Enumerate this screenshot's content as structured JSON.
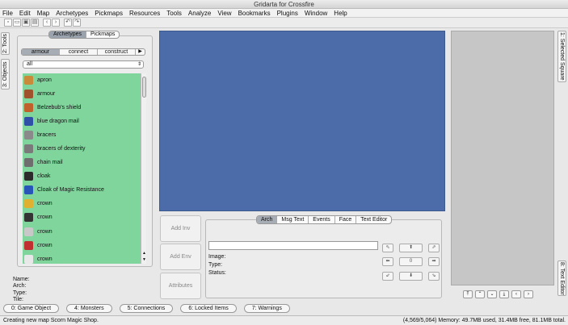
{
  "window": {
    "title": "Gridarta for Crossfire"
  },
  "menu": [
    "File",
    "Edit",
    "Map",
    "Archetypes",
    "Pickmaps",
    "Resources",
    "Tools",
    "Analyze",
    "View",
    "Bookmarks",
    "Plugins",
    "Window",
    "Help"
  ],
  "toolbar": {
    "buttons": [
      {
        "name": "new-map-icon",
        "glyph": "▫"
      },
      {
        "name": "open-map-icon",
        "glyph": "▭"
      },
      {
        "name": "save-map-icon",
        "glyph": "▣"
      },
      {
        "name": "save-all-icon",
        "glyph": "▤"
      },
      {
        "name": "back-icon",
        "glyph": "‹"
      },
      {
        "name": "forward-icon",
        "glyph": "›"
      },
      {
        "name": "undo-icon",
        "glyph": "↶"
      },
      {
        "name": "redo-icon",
        "glyph": "↷"
      }
    ]
  },
  "left_tabs": [
    "2: Tools",
    "3: Objects"
  ],
  "right_tabs": [
    "1: Selected Square",
    "8: Text Editor"
  ],
  "panel_tabs": [
    "Archetypes",
    "Pickmaps"
  ],
  "category_tabs": [
    "armour",
    "connect",
    "construct"
  ],
  "category_more": "▶",
  "filter": {
    "value": "all"
  },
  "archetypes": [
    {
      "label": "apron",
      "color": "#c98a3a"
    },
    {
      "label": "armour",
      "color": "#a0522d"
    },
    {
      "label": "Belzebub's shield",
      "color": "#c0602a"
    },
    {
      "label": "blue dragon mail",
      "color": "#3050a8"
    },
    {
      "label": "bracers",
      "color": "#8a8a8a"
    },
    {
      "label": "bracers of dexterity",
      "color": "#7a7a7a"
    },
    {
      "label": "chain mail",
      "color": "#6e6e6e"
    },
    {
      "label": "cloak",
      "color": "#2b2b2b"
    },
    {
      "label": "Cloak of Magic Resistance",
      "color": "#2855b8"
    },
    {
      "label": "crown",
      "color": "#e0b030"
    },
    {
      "label": "crown",
      "color": "#333333"
    },
    {
      "label": "crown",
      "color": "#c8c8c8"
    },
    {
      "label": "crown",
      "color": "#c03030"
    },
    {
      "label": "crown",
      "color": "#e8e8e8"
    }
  ],
  "info": {
    "name": "Name:",
    "arch": "Arch:",
    "type": "Type:",
    "tile": "Tile:"
  },
  "actions": {
    "add_inv": "Add Inv",
    "add_env": "Add Env",
    "attributes": "Attributes"
  },
  "attr_tabs": [
    "Arch",
    "Msg Text",
    "Events",
    "Face",
    "Text Editor"
  ],
  "attr_fields": {
    "image": "Image:",
    "type": "Type:",
    "status": "Status:"
  },
  "direction": {
    "value": "0"
  },
  "bottom_tabs": [
    "0: Game Object",
    "4: Monsters",
    "5: Connections",
    "6: Locked Items",
    "7: Warnings"
  ],
  "status": {
    "message": "Creating new map Scorn Magic Shop.",
    "info": "(4,569/5,064) Memory: 49.7MB used, 31.4MB free, 81.1MB total."
  },
  "colors": {
    "map": "#4b6ca8",
    "list": "#7fd59b"
  }
}
